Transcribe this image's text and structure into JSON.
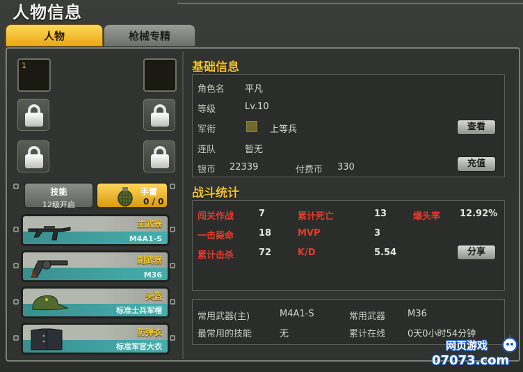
{
  "window": {
    "title": "人物信息"
  },
  "tabs": [
    {
      "label": "人物",
      "active": true
    },
    {
      "label": "枪械专精",
      "active": false
    }
  ],
  "left": {
    "slot1_number": "1",
    "skill": {
      "label": "技能",
      "sub": "12级开启"
    },
    "grenade": {
      "label": "手雷",
      "count": "0 / 0"
    },
    "equipment": [
      {
        "slot": "主武器",
        "name": "M4A1-S",
        "icon": "rifle-icon"
      },
      {
        "slot": "副武器",
        "name": "M36",
        "icon": "revolver-icon"
      },
      {
        "slot": "头盔",
        "name": "标准士兵军帽",
        "icon": "cap-icon"
      },
      {
        "slot": "防弹衣",
        "name": "标准军官大衣",
        "icon": "coat-icon"
      }
    ]
  },
  "basic": {
    "title": "基础信息",
    "name_label": "角色名",
    "name": "平凡",
    "level_label": "等级",
    "level": "Lv.10",
    "rank_label": "军衔",
    "rank": "上等兵",
    "team_label": "连队",
    "team": "暂无",
    "silver_label": "银币",
    "silver": "22339",
    "paid_label": "付费币",
    "paid": "330",
    "view_btn": "查看",
    "recharge_btn": "充值"
  },
  "combat": {
    "title": "战斗统计",
    "stats": [
      {
        "label": "闯关作战",
        "value": "7"
      },
      {
        "label": "累计死亡",
        "value": "13"
      },
      {
        "label": "爆头率",
        "value": "12.92%"
      },
      {
        "label": "一击毙命",
        "value": "18"
      },
      {
        "label": "MVP",
        "value": "3"
      },
      {
        "label": "累计击杀",
        "value": "72"
      },
      {
        "label": "K/D",
        "value": "5.54"
      }
    ],
    "share_btn": "分享"
  },
  "summary": {
    "main_weapon_label": "常用武器(主)",
    "main_weapon": "M4A1-S",
    "weapon_label": "常用武器",
    "weapon": "M36",
    "skill_label": "最常用的技能",
    "skill": "无",
    "online_label": "累计在线",
    "online": "0天0小时54分钟"
  },
  "watermark": {
    "line1": "网页游戏",
    "line2": "07073.com"
  },
  "colors": {
    "accent": "#f4c430",
    "stat_red": "#e63a2e",
    "teal": "#2c8a8a"
  }
}
